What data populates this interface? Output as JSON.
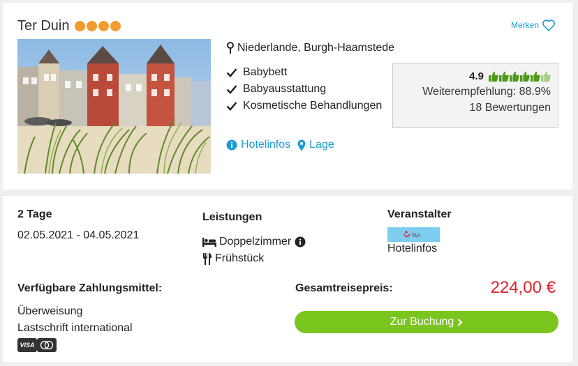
{
  "hotel": {
    "name": "Ter Duin",
    "star_count": 4,
    "merken_label": "Merken",
    "location": "Niederlande, Burgh-Haamstede",
    "features": [
      "Babybett",
      "Babyausstattung",
      "Kosmetische Behandlungen"
    ],
    "rating": {
      "score": "4.9",
      "recommendation": "Weiterempfehlung: 88.9%",
      "reviews": "18 Bewertungen",
      "thumbs_total": 6,
      "thumbs_full": 5
    },
    "links": {
      "hotelinfos": "Hotelinfos",
      "lage": "Lage"
    }
  },
  "offer": {
    "duration": "2 Tage",
    "dates": "02.05.2021 - 04.05.2021",
    "services_title": "Leistungen",
    "room": "Doppelzimmer",
    "board": "Frühstück",
    "operator_title": "Veranstalter",
    "operator_logo_text": "TUI",
    "operator_link": "Hotelinfos",
    "payment_title": "Verfügbare Zahlungsmittel:",
    "payment_methods": [
      "Überweisung",
      "Lastschrift international"
    ],
    "price_title": "Gesamtreisepreis:",
    "price": "224,00 €",
    "book_label": "Zur Buchung",
    "card_brands": [
      "VISA",
      "Mastercard"
    ]
  },
  "colors": {
    "star": "#f39c2e",
    "link": "#1a9bd7",
    "price": "#e0202a",
    "button": "#7ac51e",
    "thumb": "#4f9a1c"
  }
}
